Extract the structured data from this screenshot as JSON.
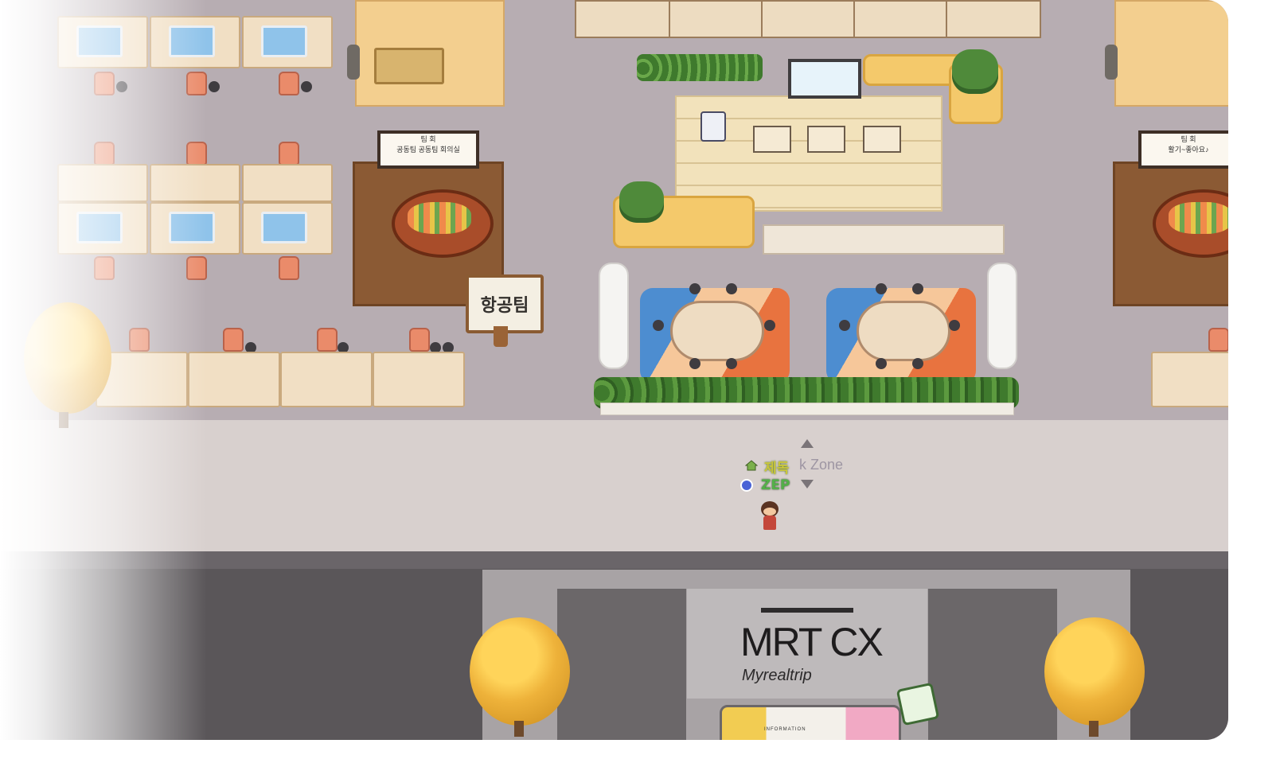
{
  "scene": {
    "team_sign": "항공팀",
    "player_name": "제독",
    "zone_label": "k Zone",
    "zep_label": "ZEP",
    "brand_title": "MRT CX",
    "brand_subtitle": "Myrealtrip",
    "info_desk_label": "INFORMATION",
    "board_left_line1": "팀 회",
    "board_left_line2": "공동팀 공동팀 회의실",
    "board_right_line1": "팀 회",
    "board_right_line2": "활기~좋아요♪"
  },
  "icons": {
    "nav_up": "chevron-up-icon",
    "nav_down": "chevron-down-icon",
    "home": "home-icon",
    "zep": "zep-badge-icon"
  },
  "colors": {
    "floor": "#b7adb2",
    "walkway": "#d8d0ce",
    "lobby": "#5a5659",
    "accent_zep": "#54b049",
    "tree": "#eeb23a"
  }
}
